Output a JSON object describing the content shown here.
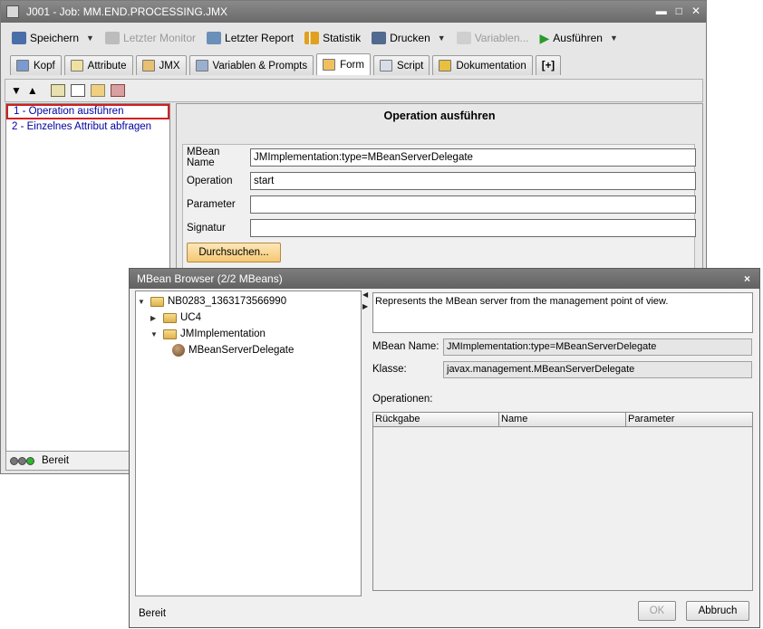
{
  "window": {
    "title": "J001 - Job: MM.END.PROCESSING.JMX"
  },
  "toolbar": {
    "save": "Speichern",
    "last_monitor": "Letzter Monitor",
    "last_report": "Letzter Report",
    "statistics": "Statistik",
    "print": "Drucken",
    "variables": "Variablen...",
    "execute": "Ausführen"
  },
  "tabs": [
    {
      "label": "Kopf"
    },
    {
      "label": "Attribute"
    },
    {
      "label": "JMX"
    },
    {
      "label": "Variablen & Prompts"
    },
    {
      "label": "Form"
    },
    {
      "label": "Script"
    },
    {
      "label": "Dokumentation"
    },
    {
      "label": "[+]"
    }
  ],
  "list": {
    "items": [
      {
        "label": "1 - Operation ausführen"
      },
      {
        "label": "2 - Einzelnes Attribut abfragen"
      }
    ]
  },
  "status": {
    "text": "Bereit"
  },
  "form": {
    "title": "Operation ausführen",
    "mbean_label": "MBean Name",
    "mbean_value": "JMImplementation:type=MBeanServerDelegate",
    "operation_label": "Operation",
    "operation_value": "start",
    "parameter_label": "Parameter",
    "parameter_value": "",
    "signature_label": "Signatur",
    "signature_value": "",
    "browse_button": "Durchsuchen..."
  },
  "dialog": {
    "title": "MBean Browser (2/2 MBeans)",
    "close": "×",
    "tree": {
      "root": "NB0283_1363173566990",
      "nodes": [
        "UC4",
        "JMImplementation"
      ],
      "leaf": "MBeanServerDelegate"
    },
    "description": "Represents  the MBean server from the management point of view.",
    "mbean_name_label": "MBean Name:",
    "mbean_name_value": "JMImplementation:type=MBeanServerDelegate",
    "class_label": "Klasse:",
    "class_value": "javax.management.MBeanServerDelegate",
    "operations_label": "Operationen:",
    "columns": [
      "Rückgabe",
      "Name",
      "Parameter"
    ],
    "status": "Bereit",
    "ok_button": "OK",
    "cancel_button": "Abbruch"
  }
}
